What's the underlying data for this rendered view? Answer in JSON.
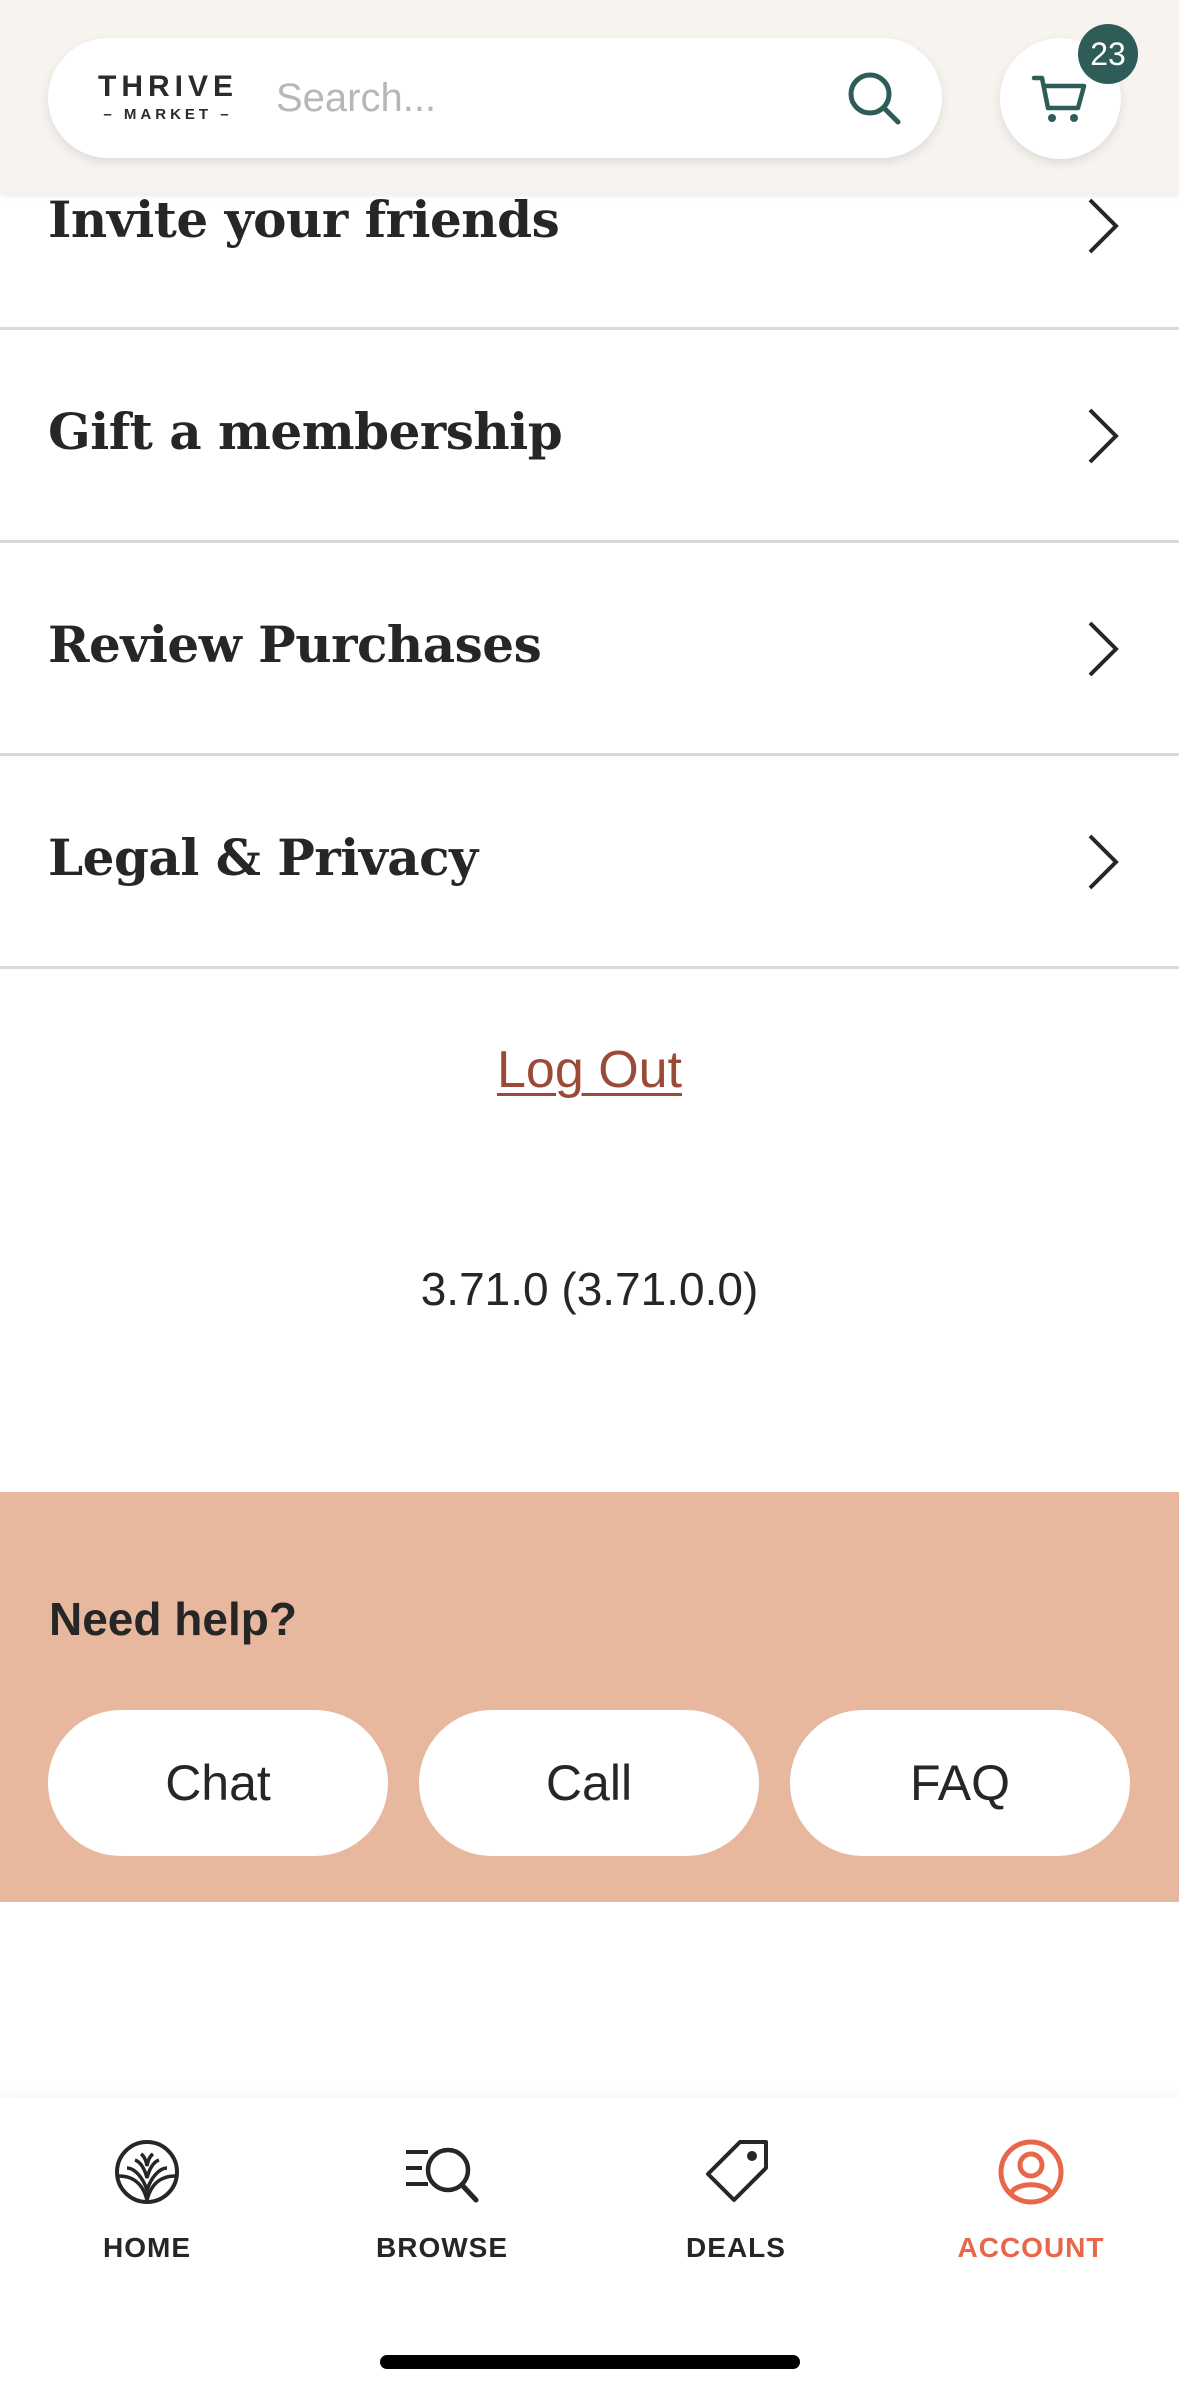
{
  "header": {
    "logo_top": "THRIVE",
    "logo_bottom": "– MARKET –",
    "search_placeholder": "Search...",
    "cart_count": "23"
  },
  "menu": {
    "items": [
      {
        "label": "Invite your friends"
      },
      {
        "label": "Gift a membership"
      },
      {
        "label": "Review Purchases"
      },
      {
        "label": "Legal & Privacy"
      }
    ]
  },
  "logout_label": "Log Out",
  "version": "3.71.0 (3.71.0.0)",
  "help": {
    "title": "Need help?",
    "buttons": [
      {
        "label": "Chat"
      },
      {
        "label": "Call"
      },
      {
        "label": "FAQ"
      }
    ]
  },
  "bottom_nav": {
    "items": [
      {
        "label": "HOME",
        "icon": "home-icon"
      },
      {
        "label": "BROWSE",
        "icon": "browse-icon"
      },
      {
        "label": "DEALS",
        "icon": "deals-tag-icon"
      },
      {
        "label": "ACCOUNT",
        "icon": "account-icon",
        "active": true
      }
    ]
  },
  "colors": {
    "header_bg": "#f7f3ef",
    "badge_bg": "#2e5c58",
    "help_bg": "#e8b89e",
    "logout_text": "#9a4a36",
    "active_nav": "#e8674a",
    "divider": "#d9d9d9"
  }
}
